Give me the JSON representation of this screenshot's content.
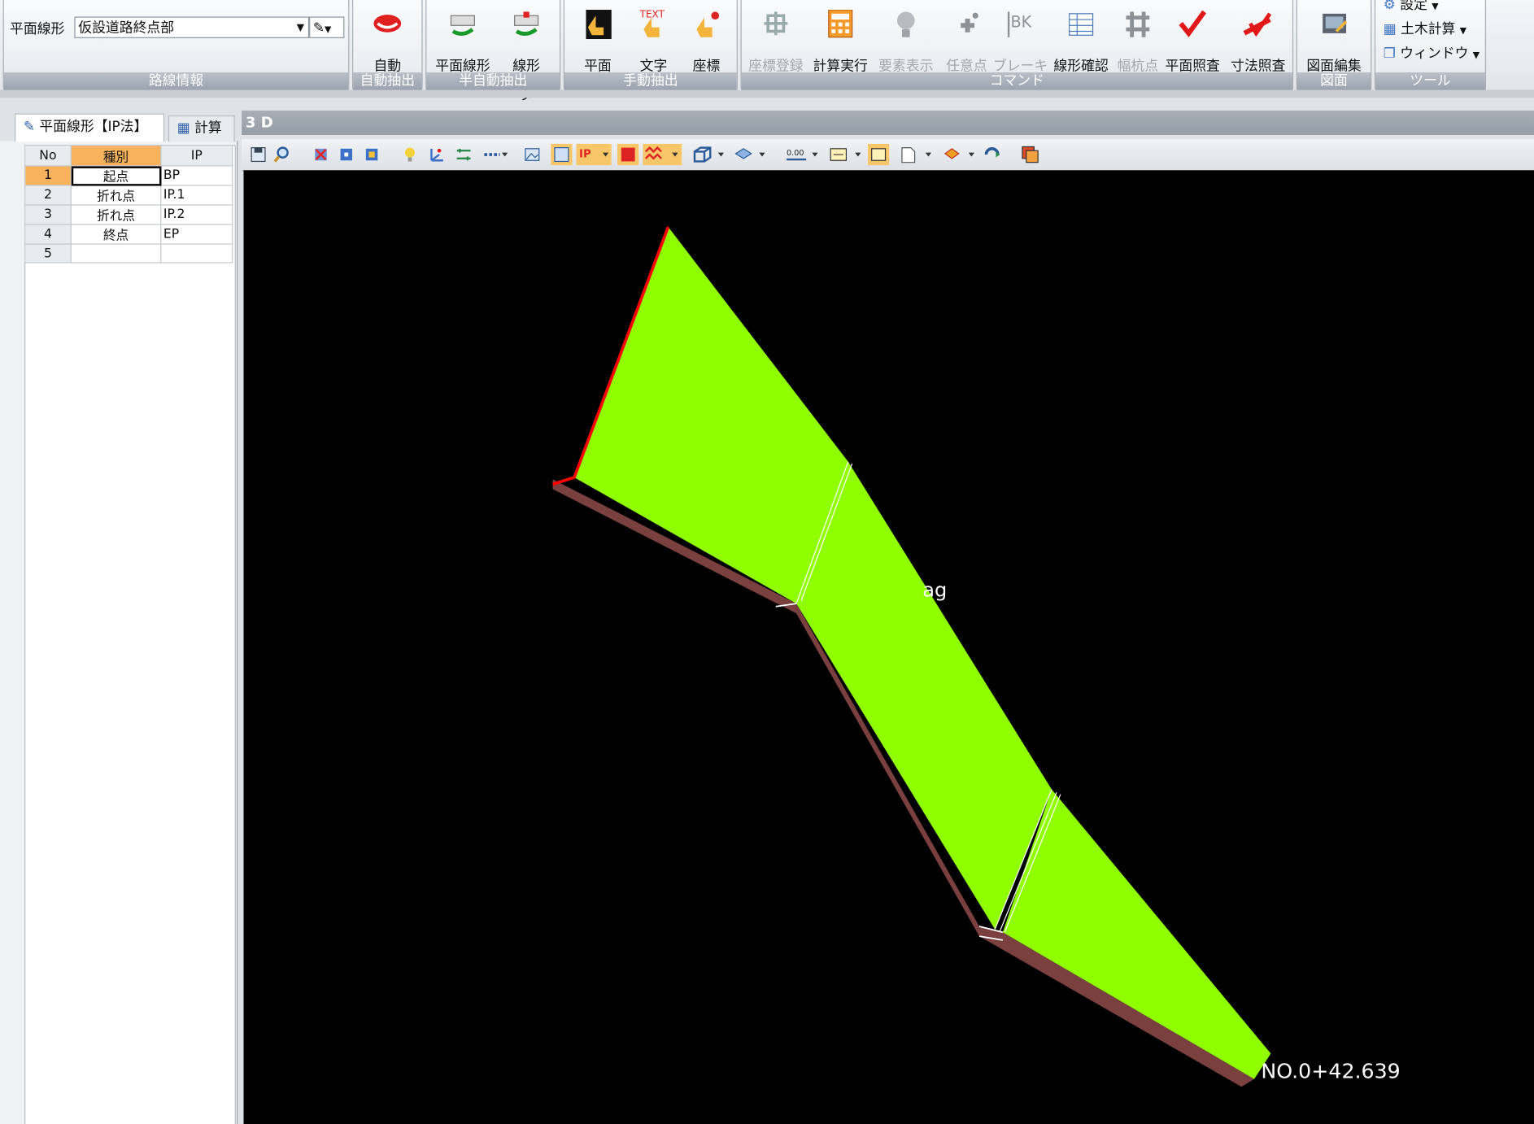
{
  "ribbon": {
    "route_label": "平面線形",
    "route_value": "仮設道路終点部",
    "groups": {
      "route_info": "路線情報",
      "auto_extract": "自動抽出",
      "semi_auto_extract": "半自動抽出",
      "manual_extract": "手動抽出",
      "command": "コマンド",
      "drawing": "図面",
      "tools": "ツール"
    },
    "buttons": {
      "auto": "自動",
      "plan_alignment": "平面線形",
      "alignment_params": "線形\nパラメータ",
      "plan_preview": "平面\nプレビュー",
      "text": "文字",
      "coords": "座標",
      "coord_register": "座標登録",
      "calc_run": "計算実行",
      "element_display": "要素表示",
      "add_point": "任意点\n追加",
      "break_setting": "ブレーキ\n設定",
      "alignment_check": "線形確認",
      "width_stake": "幅杭点",
      "plan_check": "平面照査",
      "dimension_check": "寸法照査",
      "drawing_edit": "図面編集",
      "settings": "設定",
      "civil_calc": "土木計算",
      "window": "ウィンドウ"
    },
    "text_icon_label": "TEXT"
  },
  "left_panel": {
    "tab_active": "平面線形【IP法】",
    "tab_inactive": "計算",
    "table": {
      "headers": [
        "No",
        "種別",
        "IP"
      ],
      "rows": [
        {
          "no": "1",
          "type": "起点",
          "ip": "BP"
        },
        {
          "no": "2",
          "type": "折れ点",
          "ip": "IP.1"
        },
        {
          "no": "3",
          "type": "折れ点",
          "ip": "IP.2"
        },
        {
          "no": "4",
          "type": "終点",
          "ip": "EP"
        },
        {
          "no": "5",
          "type": "",
          "ip": ""
        }
      ]
    }
  },
  "view3d": {
    "title": "3 D",
    "station_label": "NO.0+42.639",
    "partial_label": "ag",
    "road_color": "#90ff00",
    "side_color": "#7a3f3f",
    "edge_color": "#ff0000"
  }
}
